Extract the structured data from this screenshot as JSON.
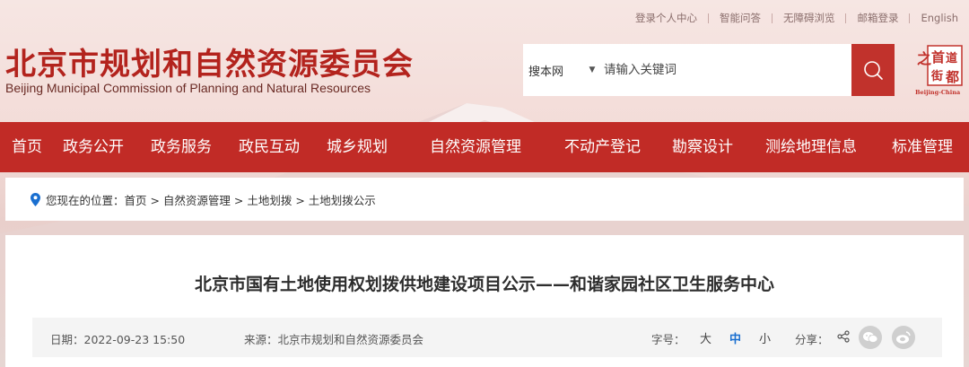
{
  "toplinks": [
    "登录个人中心",
    "智能问答",
    "无障碍浏览",
    "邮箱登录",
    "English"
  ],
  "logo": {
    "title_cn": "北京市规划和自然资源委员会",
    "title_en": "Beijing Municipal Commission of Planning and Natural Resources"
  },
  "search": {
    "scope": "搜本网",
    "placeholder": "请输入关键词",
    "button_icon": "search-icon"
  },
  "seal": {
    "chars": [
      "之",
      "首",
      "都",
      "街",
      "道"
    ],
    "caption": "Beijing-China"
  },
  "nav": [
    "首页",
    "政务公开",
    "政务服务",
    "政民互动",
    "城乡规划",
    "自然资源管理",
    "不动产登记",
    "勘察设计",
    "测绘地理信息",
    "标准管理"
  ],
  "breadcrumb": {
    "text": "您现在的位置：首页 > 自然资源管理 > 土地划拨 > 土地划拨公示"
  },
  "article": {
    "title": "北京市国有土地使用权划拨供地建设项目公示——和谐家园社区卫生服务中心",
    "date": "日期：2022-09-23 15:50",
    "source": "来源：北京市规划和自然资源委员会",
    "font_size_label": "字号：",
    "font_sizes": [
      "大",
      "中",
      "小"
    ],
    "font_size_active": "中",
    "share_label": "分享："
  },
  "colors": {
    "brand_red": "#c12b26",
    "active_blue": "#1a6fd0"
  }
}
